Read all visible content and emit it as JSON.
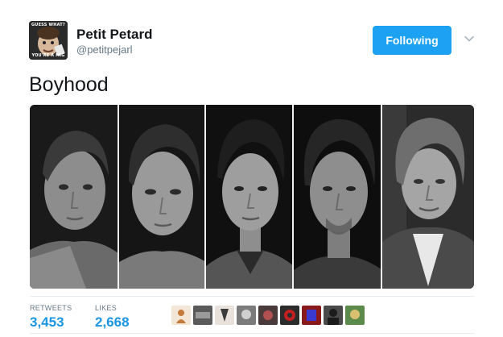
{
  "author": {
    "name": "Petit Petard",
    "handle": "@petitpejarl",
    "avatar_caption_top": "GUESS WHAT?",
    "avatar_caption_bottom": "YOU'RE A FAG"
  },
  "follow_button": {
    "label": "Following",
    "color": "#1da1f2"
  },
  "menu_icon": "chevron-down-icon",
  "tweet": {
    "text": "Boyhood"
  },
  "media": {
    "panels": [
      {
        "name": "portrait-1",
        "bg": "#1a1a1a",
        "skin": "#8a8a8a",
        "hair": "#3a3a3a",
        "shirt": "#6a6a6a"
      },
      {
        "name": "portrait-2",
        "bg": "#151515",
        "skin": "#9a9a9a",
        "hair": "#2e2e2e",
        "shirt": "#7a7a7a"
      },
      {
        "name": "portrait-3",
        "bg": "#101010",
        "skin": "#9e9e9e",
        "hair": "#1e1e1e",
        "shirt": "#555555"
      },
      {
        "name": "portrait-4",
        "bg": "#0e0e0e",
        "skin": "#8e8e8e",
        "hair": "#262626",
        "shirt": "#3a3a3a"
      },
      {
        "name": "portrait-5",
        "bg": "#2b2b2b",
        "skin": "#a5a5a5",
        "hair": "#6e6e6e",
        "shirt": "#4a4a4a"
      }
    ]
  },
  "stats": {
    "retweets_label": "RETWEETS",
    "retweets_value": "3,453",
    "likes_label": "LIKES",
    "likes_value": "2,668",
    "accent_color": "#1b95e0"
  },
  "likers": [
    {
      "bg": "#f3e6d6",
      "fg": "#c47a3a"
    },
    {
      "bg": "#5a5a5a",
      "fg": "#9a9a9a"
    },
    {
      "bg": "#e9e2dc",
      "fg": "#3b3b3b"
    },
    {
      "bg": "#7b7b7b",
      "fg": "#d0d0d0"
    },
    {
      "bg": "#4a3a3a",
      "fg": "#b05050"
    },
    {
      "bg": "#2b2b2b",
      "fg": "#c02020"
    },
    {
      "bg": "#8a1a1a",
      "fg": "#3a3ad0"
    },
    {
      "bg": "#4a4a4a",
      "fg": "#1b1b1b"
    },
    {
      "bg": "#5b8a4a",
      "fg": "#d8c070"
    }
  ]
}
